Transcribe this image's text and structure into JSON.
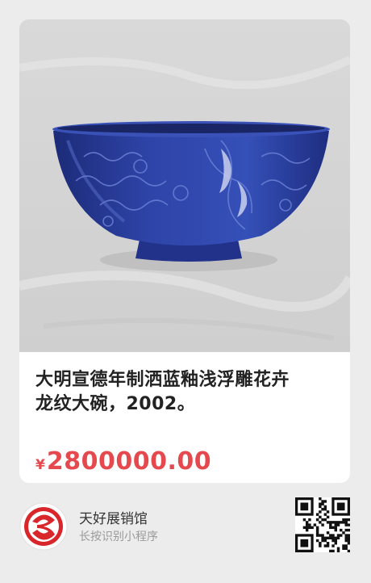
{
  "product": {
    "image_alt": "blue glazed bowl",
    "title_line1": "大明宣德年制洒蓝釉浅浮雕花卉",
    "title_line2": "龙纹大碗，2002。",
    "currency_symbol": "¥",
    "price": "2800000.00"
  },
  "footer": {
    "shop_name": "天好展销馆",
    "hint": "长按识别小程序",
    "logo_icon": "red-3-logo-icon",
    "qr_icon": "qr-code-icon"
  },
  "colors": {
    "price": "#e5484d",
    "logo": "#d8262b",
    "bowl": "#2a3d9a",
    "background": "#ececec"
  }
}
